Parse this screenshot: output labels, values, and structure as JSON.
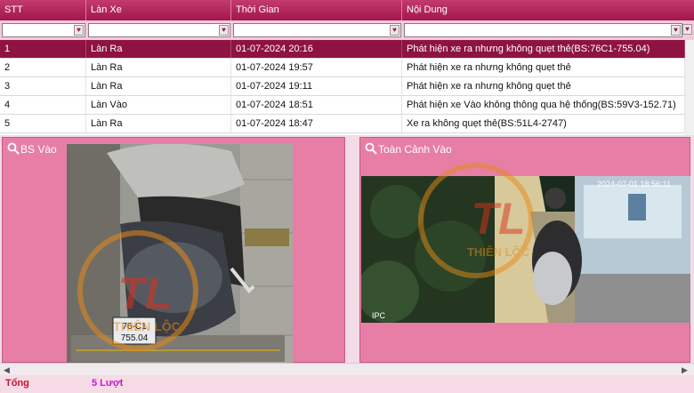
{
  "grid": {
    "columns": [
      "STT",
      "Làn Xe",
      "Thời Gian",
      "Nội Dung"
    ],
    "rows": [
      {
        "stt": "1",
        "lane": "Làn Ra",
        "time": "01-07-2024 20:16",
        "content": "Phát hiện xe ra nhưng không quẹt thẻ(BS:76C1-755.04)"
      },
      {
        "stt": "2",
        "lane": "Làn Ra",
        "time": "01-07-2024 19:57",
        "content": "Phát hiện xe ra nhưng không quẹt thẻ"
      },
      {
        "stt": "3",
        "lane": "Làn Ra",
        "time": "01-07-2024 19:11",
        "content": "Phát hiện xe ra nhưng không quẹt thẻ"
      },
      {
        "stt": "4",
        "lane": "Làn Vào",
        "time": "01-07-2024 18:51",
        "content": "Phát hiện xe Vào không thông qua hệ thống(BS:59V3-152.71)"
      },
      {
        "stt": "5",
        "lane": "Làn Ra",
        "time": "01-07-2024 18:47",
        "content": "Xe ra không quẹt thẻ(BS:51L4-2747)"
      }
    ],
    "selected_row": 1
  },
  "panels": {
    "left_title": "BS Vào",
    "right_title": "Toàn Cảnh Vào",
    "plate_line1": "76-C1",
    "plate_line2": "755.04",
    "cam_timestamp": "2024-07-01 18:56:11",
    "cam_label": "IPC",
    "watermark_top": "TL",
    "watermark_bottom": "THIÊN LỘC"
  },
  "footer": {
    "total_label": "Tổng",
    "total_value": "5 Lượt"
  },
  "colors": {
    "header": "#a3174b",
    "selected_row": "#8e1340",
    "panel_bg": "#e77ea6",
    "total_label": "#c8102e",
    "total_value": "#c21acb"
  }
}
